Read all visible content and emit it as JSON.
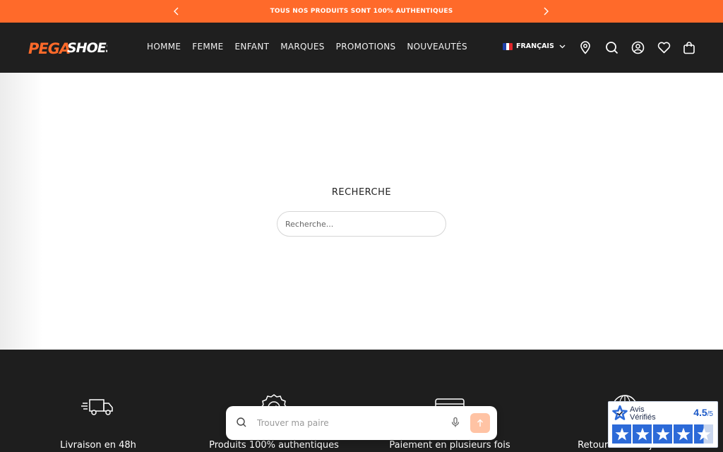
{
  "announcement": {
    "text": "TOUS NOS PRODUITS SONT 100% AUTHENTIQUES",
    "prev_icon": "chevron-left-icon",
    "next_icon": "chevron-right-icon"
  },
  "header": {
    "logo_text": "PEGASHOES",
    "nav": [
      "HOMME",
      "FEMME",
      "ENFANT",
      "MARQUES",
      "PROMOTIONS",
      "NOUVEAUTÉS"
    ],
    "language": "FRANÇAIS",
    "icons": [
      "location-icon",
      "search-icon",
      "account-icon",
      "heart-icon",
      "bag-icon"
    ]
  },
  "main": {
    "title": "RECHERCHE",
    "search_placeholder": "Recherche..."
  },
  "footer": {
    "features": [
      {
        "icon": "delivery-truck-icon",
        "label": "Livraison en 48h"
      },
      {
        "icon": "authentic-badge-icon",
        "label": "Produits 100% authentiques"
      },
      {
        "icon": "credit-card-icon",
        "label": "Paiement en plusieurs fois"
      },
      {
        "icon": "returns-globe-icon",
        "label": "Retour sous 15 jours"
      }
    ]
  },
  "finder": {
    "placeholder": "Trouver ma paire"
  },
  "reviews_widget": {
    "brand_line1": "Avis",
    "brand_line2": "Vérifiés",
    "score": "4.5",
    "score_max": "/5",
    "rating": 4.5
  },
  "colors": {
    "accent": "#ff6a2a",
    "header_bg": "#1f1f1f",
    "footer_bg": "#1e1e1e",
    "reviews_blue": "#2c6ad8"
  }
}
